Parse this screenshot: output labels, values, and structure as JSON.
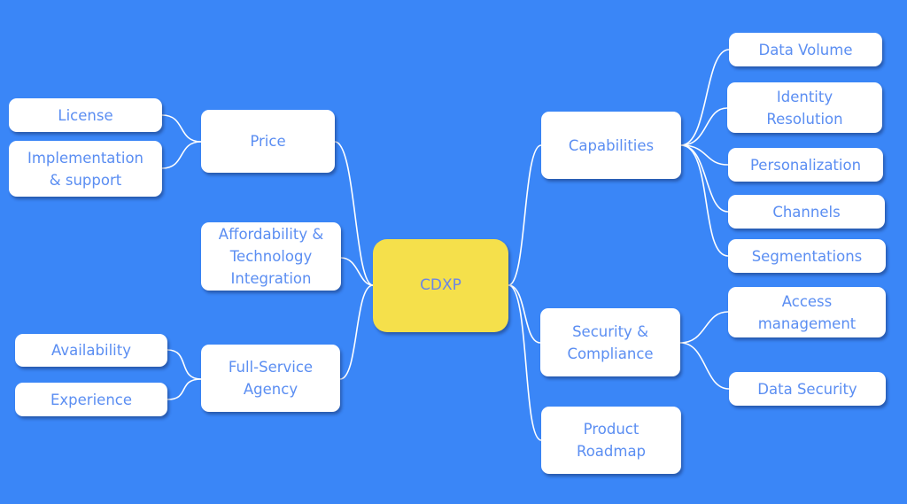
{
  "colors": {
    "background": "#3a86f7",
    "node": "#ffffff",
    "root": "#f5e04b",
    "text": "#5b8ef2",
    "link": "#ffffff"
  },
  "root": {
    "label": "CDXP"
  },
  "branches": {
    "price": {
      "label": "Price",
      "children": [
        "License",
        "Implementation\n& support"
      ]
    },
    "affordability": {
      "label": "Affordability &\nTechnology\nIntegration",
      "children": []
    },
    "agency": {
      "label": "Full-Service\nAgency",
      "children": [
        "Availability",
        "Experience"
      ]
    },
    "capabilities": {
      "label": "Capabilities",
      "children": [
        "Data Volume",
        "Identity\nResolution",
        "Personalization",
        "Channels",
        "Segmentations"
      ]
    },
    "security": {
      "label": "Security &\nCompliance",
      "children": [
        "Access\nmanagement",
        "Data Security"
      ]
    },
    "roadmap": {
      "label": "Product\nRoadmap",
      "children": []
    }
  }
}
